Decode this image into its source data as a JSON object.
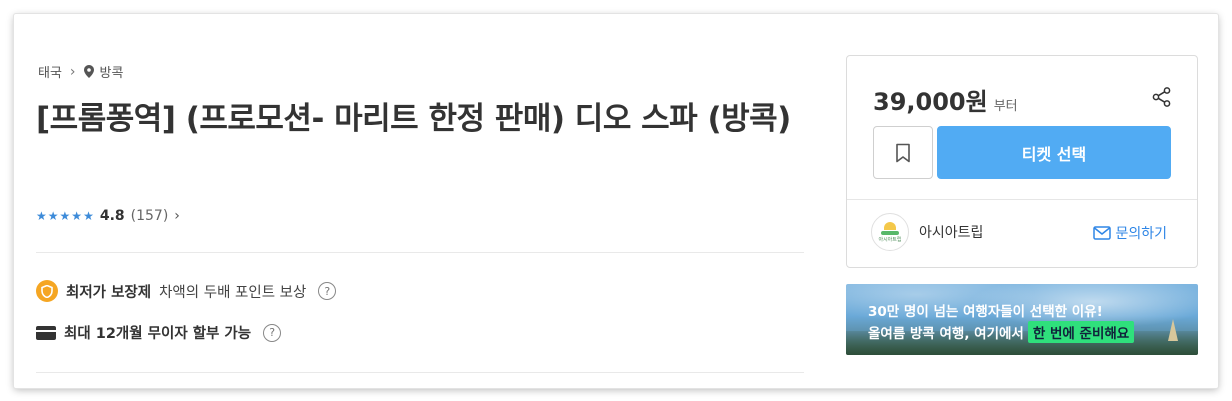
{
  "breadcrumb": {
    "country": "태국",
    "city": "방콕"
  },
  "product": {
    "title": "[프롬퐁역] (프로모션- 마리트 한정 판매) 디오 스파 (방콕)",
    "rating_score": "4.8",
    "rating_count": "(157)",
    "stars": 5
  },
  "perks": {
    "best_price_title": "최저가 보장제",
    "best_price_desc": "차액의 두배 포인트 보상",
    "installment": "최대 12개월 무이자 할부 가능"
  },
  "booking": {
    "price": "39,000원",
    "price_suffix": "부터",
    "ticket_button": "티켓 선택",
    "seller_name": "아시아트립",
    "seller_logo_text": "아시아트립",
    "inquiry_label": "문의하기"
  },
  "banner": {
    "line1": "30만 명이 넘는 여행자들이 선택한 이유!",
    "line2": "올여름 방콕 여행, 여기에서",
    "highlight": "한 번에 준비해요"
  },
  "colors": {
    "accent": "#51abf3",
    "link": "#2f86e6",
    "star": "#3d8bd9",
    "badge": "#f5a623",
    "highlight": "#2fe07c"
  },
  "icons": [
    "map-pin-icon",
    "chevron-right-icon",
    "star-icon",
    "shield-icon",
    "help-icon",
    "card-icon",
    "share-icon",
    "bookmark-icon",
    "mail-icon"
  ]
}
